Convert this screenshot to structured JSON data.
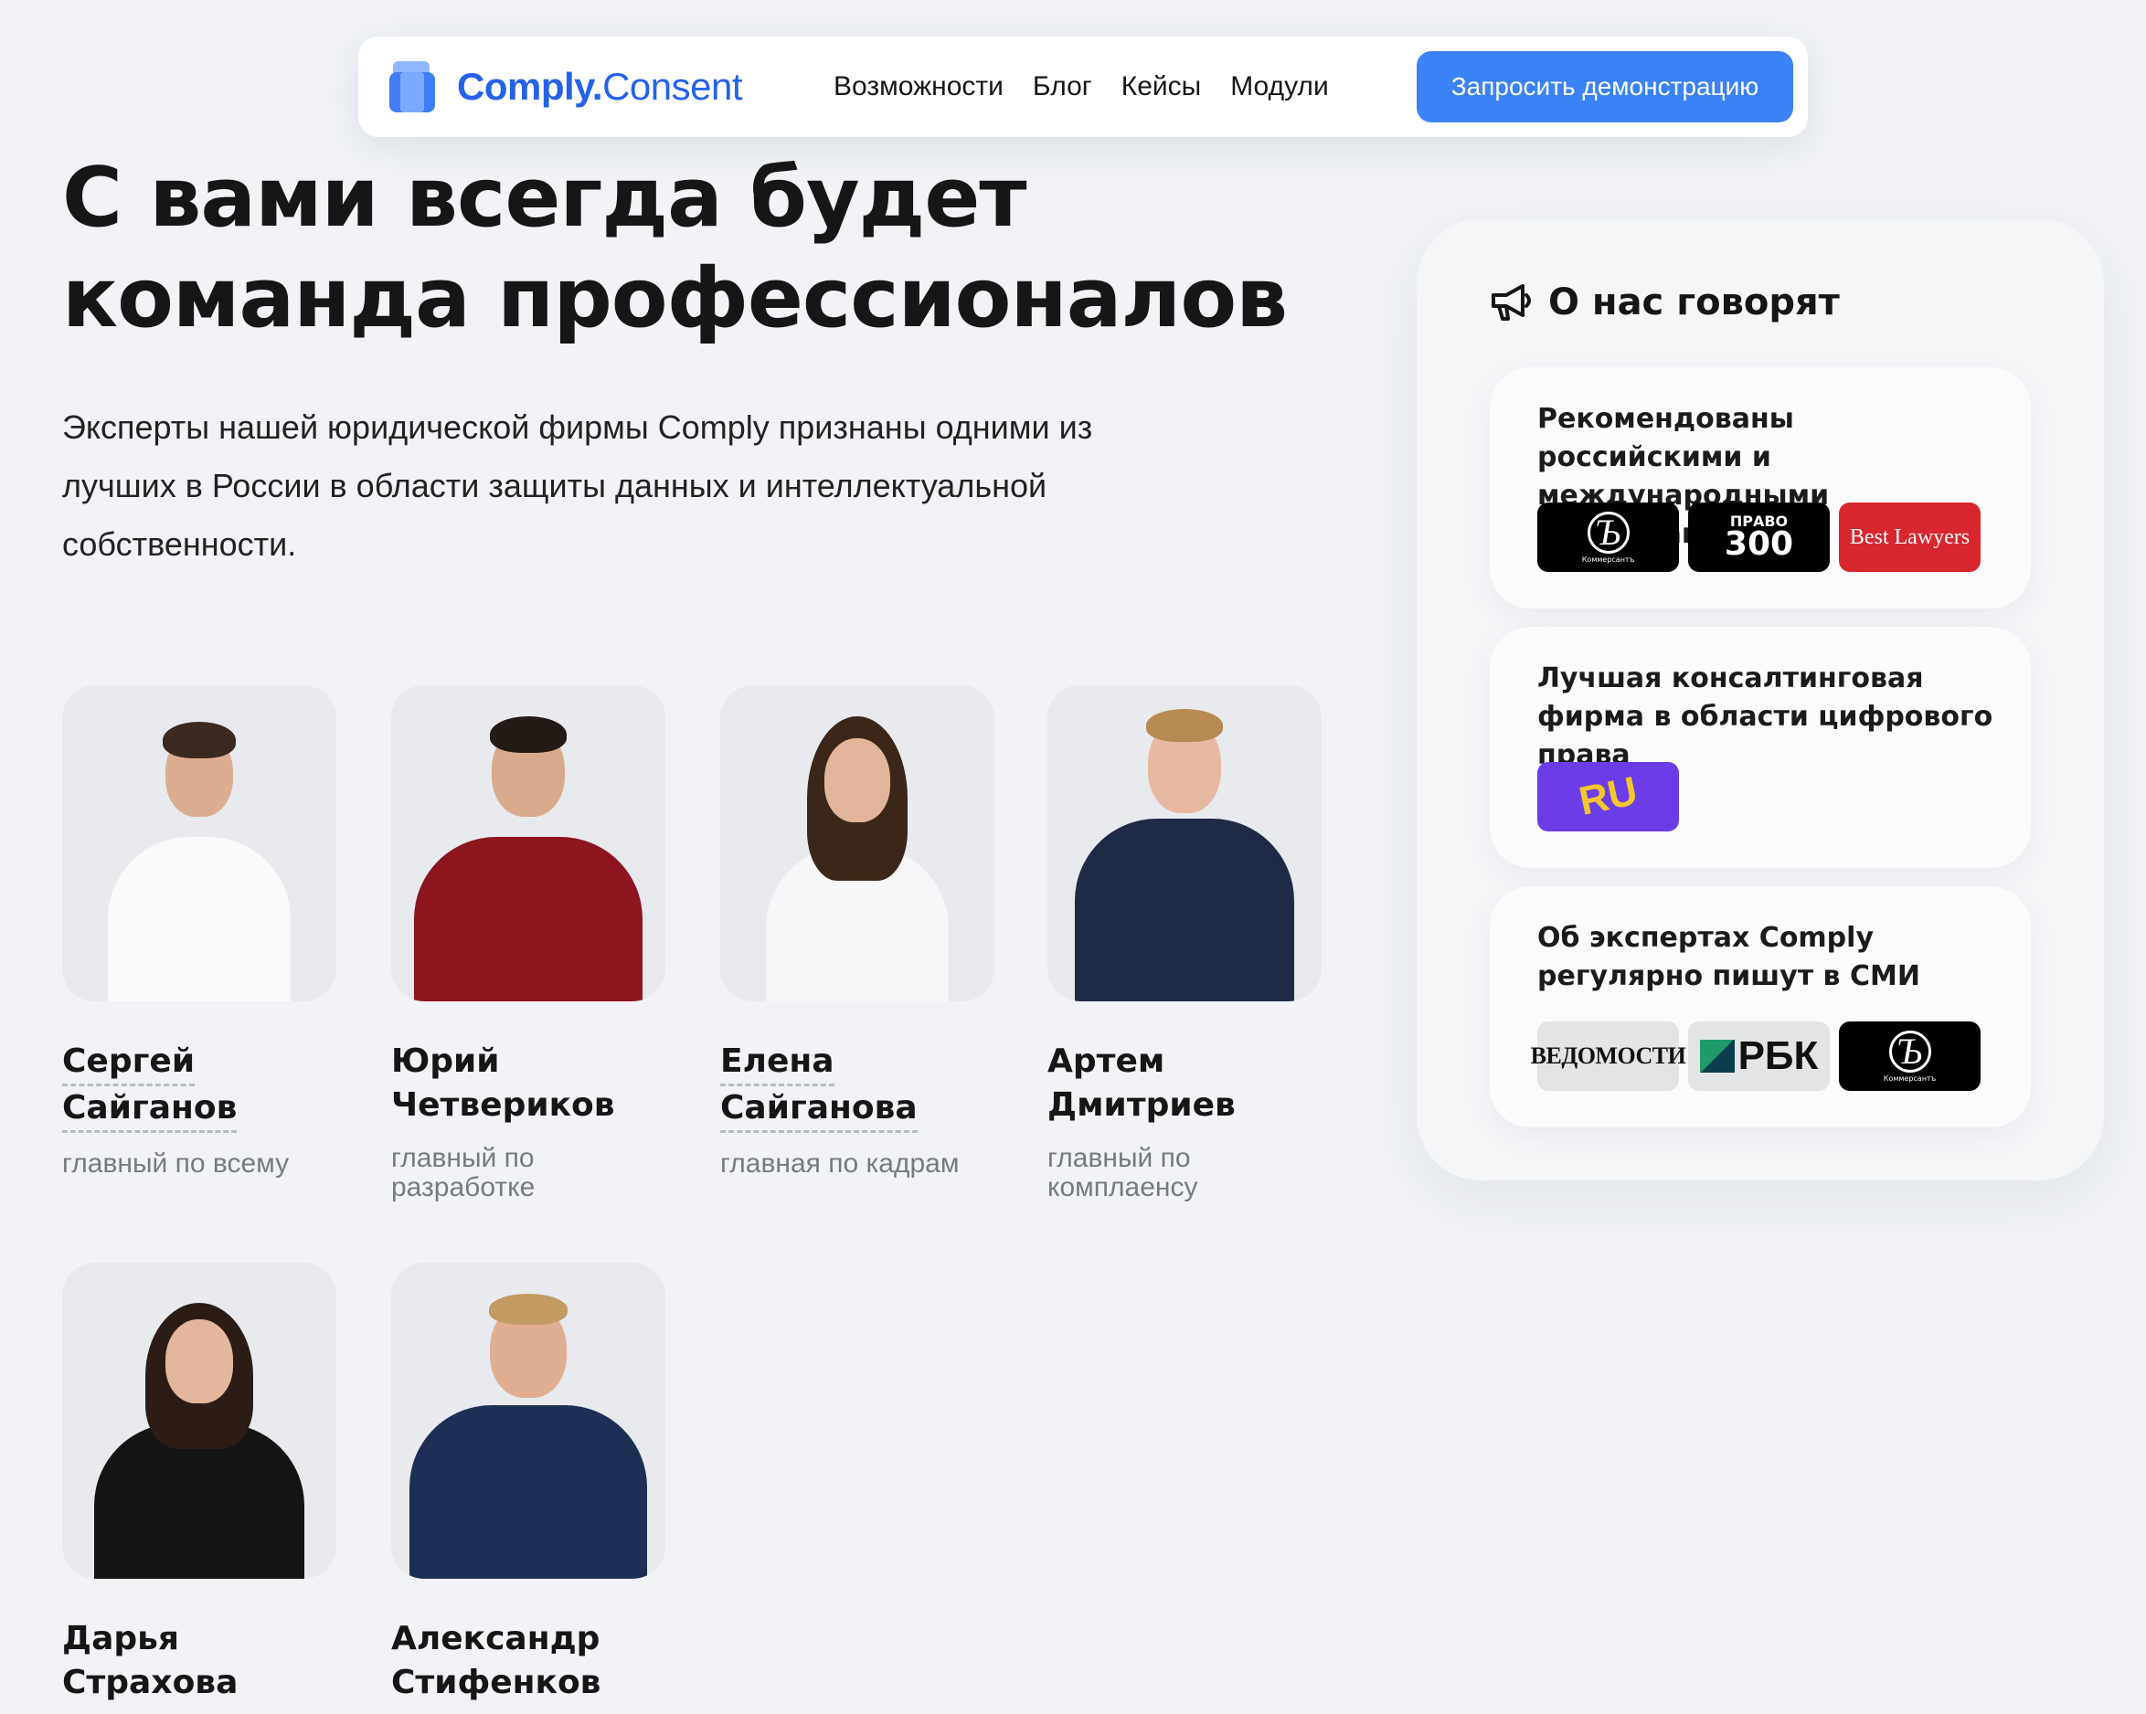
{
  "nav": {
    "logo_bold": "Comply.",
    "logo_light": "Consent",
    "menu": [
      "Возможности",
      "Блог",
      "Кейсы",
      "Модули"
    ],
    "cta": "Запросить демонстрацию"
  },
  "hero": {
    "title_line1": "С вами всегда будет",
    "title_line2": "команда профессионалов",
    "text_line1": "Эксперты нашей юридической фирмы Comply признаны одними из",
    "text_line2": "лучших в России в области защиты данных и интеллектуальной",
    "text_line3": "собственности."
  },
  "team": [
    {
      "first": "Сергей",
      "last": "Сайганов",
      "role": "главный по всему"
    },
    {
      "first": "Юрий",
      "last": "Четвериков",
      "role": "главный по разработке"
    },
    {
      "first": "Елена",
      "last": "Сайганова",
      "role": "главная по кадрам"
    },
    {
      "first": "Артем",
      "last": "Дмитриев",
      "role": "главный по комплаенсу"
    },
    {
      "first": "Дарья",
      "last": "Страхова",
      "role": ""
    },
    {
      "first": "Александр",
      "last": "Стифенков",
      "role": ""
    }
  ],
  "sidebar": {
    "title": "О нас говорят",
    "cards": [
      {
        "text": "Рекомендованы российскими и международными рейтингами"
      },
      {
        "text": "Лучшая консалтинговая фирма в области цифрового права"
      },
      {
        "text": "Об экспертах Comply регулярно пишут в СМИ"
      }
    ],
    "logos": {
      "kommersant": "Коммерсантъ",
      "pravo_top": "ПРАВО",
      "pravo_num": "300",
      "best_lawyers": "Best Lawyers",
      "ru": "RU",
      "vedomosti": "ВЕДОМОСТИ",
      "rbk": "РБК"
    }
  },
  "colors": {
    "accent": "#3b82f6",
    "brand": "#2562e8",
    "background": "#f1f3f6"
  }
}
